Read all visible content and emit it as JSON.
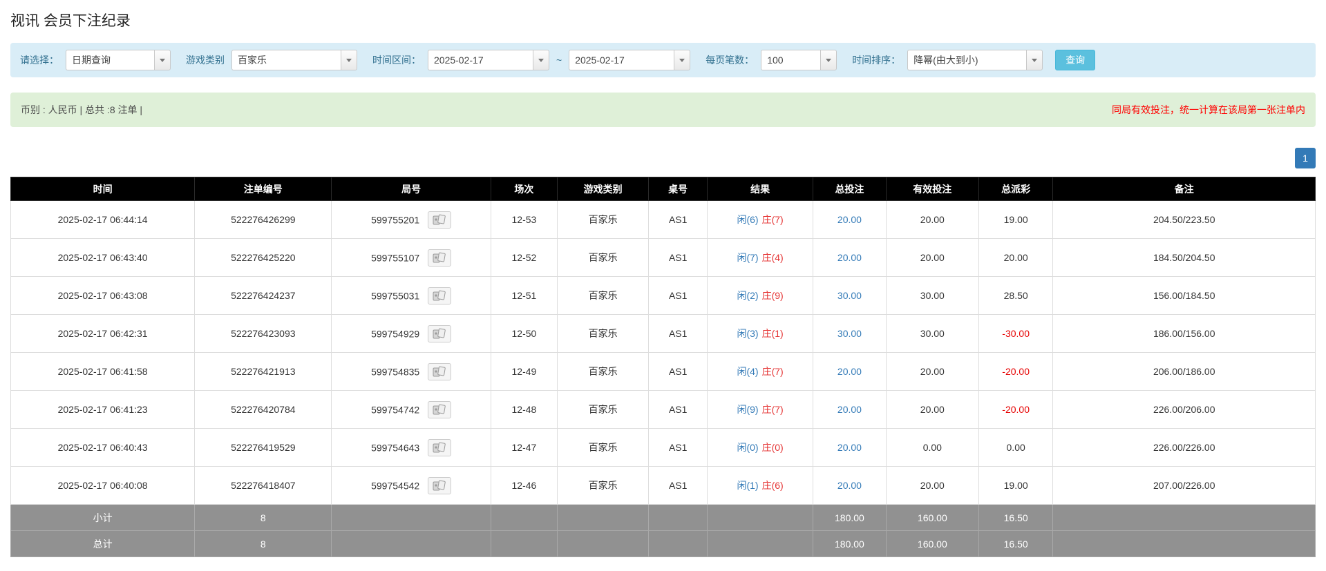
{
  "page": {
    "title": "视讯 会员下注纪录"
  },
  "filters": {
    "query_type": {
      "label": "请选择：",
      "value": "日期查询"
    },
    "game_type": {
      "label": "游戏类别",
      "value": "百家乐"
    },
    "date_range": {
      "label": "时间区间：",
      "from": "2025-02-17",
      "separator": "~",
      "to": "2025-02-17"
    },
    "page_size": {
      "label": "每页笔数：",
      "value": "100"
    },
    "sort": {
      "label": "时间排序：",
      "value": "降幂(由大到小)"
    },
    "search_button": "查询"
  },
  "summary": {
    "left_text": "币别 : 人民币 | 总共 :8 注单 |",
    "right_notice": "同局有效投注，统一计算在该局第一张注单内"
  },
  "pagination": {
    "page": "1"
  },
  "table": {
    "headers": [
      "时间",
      "注单编号",
      "局号",
      "场次",
      "游戏类别",
      "桌号",
      "结果",
      "总投注",
      "有效投注",
      "总派彩",
      "备注"
    ],
    "rows": [
      {
        "time": "2025-02-17 06:44:14",
        "bet_id": "522276426299",
        "round_id": "599755201",
        "session": "12-53",
        "game": "百家乐",
        "table_no": "AS1",
        "result_player": "闲(6)",
        "result_banker": "庄(7)",
        "total_bet": "20.00",
        "valid_bet": "20.00",
        "payout": "19.00",
        "remark": "204.50/223.50"
      },
      {
        "time": "2025-02-17 06:43:40",
        "bet_id": "522276425220",
        "round_id": "599755107",
        "session": "12-52",
        "game": "百家乐",
        "table_no": "AS1",
        "result_player": "闲(7)",
        "result_banker": "庄(4)",
        "total_bet": "20.00",
        "valid_bet": "20.00",
        "payout": "20.00",
        "remark": "184.50/204.50"
      },
      {
        "time": "2025-02-17 06:43:08",
        "bet_id": "522276424237",
        "round_id": "599755031",
        "session": "12-51",
        "game": "百家乐",
        "table_no": "AS1",
        "result_player": "闲(2)",
        "result_banker": "庄(9)",
        "total_bet": "30.00",
        "valid_bet": "30.00",
        "payout": "28.50",
        "remark": "156.00/184.50"
      },
      {
        "time": "2025-02-17 06:42:31",
        "bet_id": "522276423093",
        "round_id": "599754929",
        "session": "12-50",
        "game": "百家乐",
        "table_no": "AS1",
        "result_player": "闲(3)",
        "result_banker": "庄(1)",
        "total_bet": "30.00",
        "valid_bet": "30.00",
        "payout": "-30.00",
        "remark": "186.00/156.00"
      },
      {
        "time": "2025-02-17 06:41:58",
        "bet_id": "522276421913",
        "round_id": "599754835",
        "session": "12-49",
        "game": "百家乐",
        "table_no": "AS1",
        "result_player": "闲(4)",
        "result_banker": "庄(7)",
        "total_bet": "20.00",
        "valid_bet": "20.00",
        "payout": "-20.00",
        "remark": "206.00/186.00"
      },
      {
        "time": "2025-02-17 06:41:23",
        "bet_id": "522276420784",
        "round_id": "599754742",
        "session": "12-48",
        "game": "百家乐",
        "table_no": "AS1",
        "result_player": "闲(9)",
        "result_banker": "庄(7)",
        "total_bet": "20.00",
        "valid_bet": "20.00",
        "payout": "-20.00",
        "remark": "226.00/206.00"
      },
      {
        "time": "2025-02-17 06:40:43",
        "bet_id": "522276419529",
        "round_id": "599754643",
        "session": "12-47",
        "game": "百家乐",
        "table_no": "AS1",
        "result_player": "闲(0)",
        "result_banker": "庄(0)",
        "total_bet": "20.00",
        "valid_bet": "0.00",
        "payout": "0.00",
        "remark": "226.00/226.00"
      },
      {
        "time": "2025-02-17 06:40:08",
        "bet_id": "522276418407",
        "round_id": "599754542",
        "session": "12-46",
        "game": "百家乐",
        "table_no": "AS1",
        "result_player": "闲(1)",
        "result_banker": "庄(6)",
        "total_bet": "20.00",
        "valid_bet": "20.00",
        "payout": "19.00",
        "remark": "207.00/226.00"
      }
    ],
    "subtotal": {
      "label": "小计",
      "count": "8",
      "total_bet": "180.00",
      "valid_bet": "160.00",
      "payout": "16.50"
    },
    "total": {
      "label": "总计",
      "count": "8",
      "total_bet": "180.00",
      "valid_bet": "160.00",
      "payout": "16.50"
    }
  },
  "colors": {
    "header_bg": "#000000",
    "footer_bg": "#919191",
    "filter_bg": "#d9edf7",
    "summary_bg": "#dff0d8",
    "player_blue": "#337ab7",
    "banker_red": "#e53333",
    "negative_red": "#e60000",
    "search_button_blue": "#5bc0de",
    "pagination_blue": "#337ab7"
  }
}
